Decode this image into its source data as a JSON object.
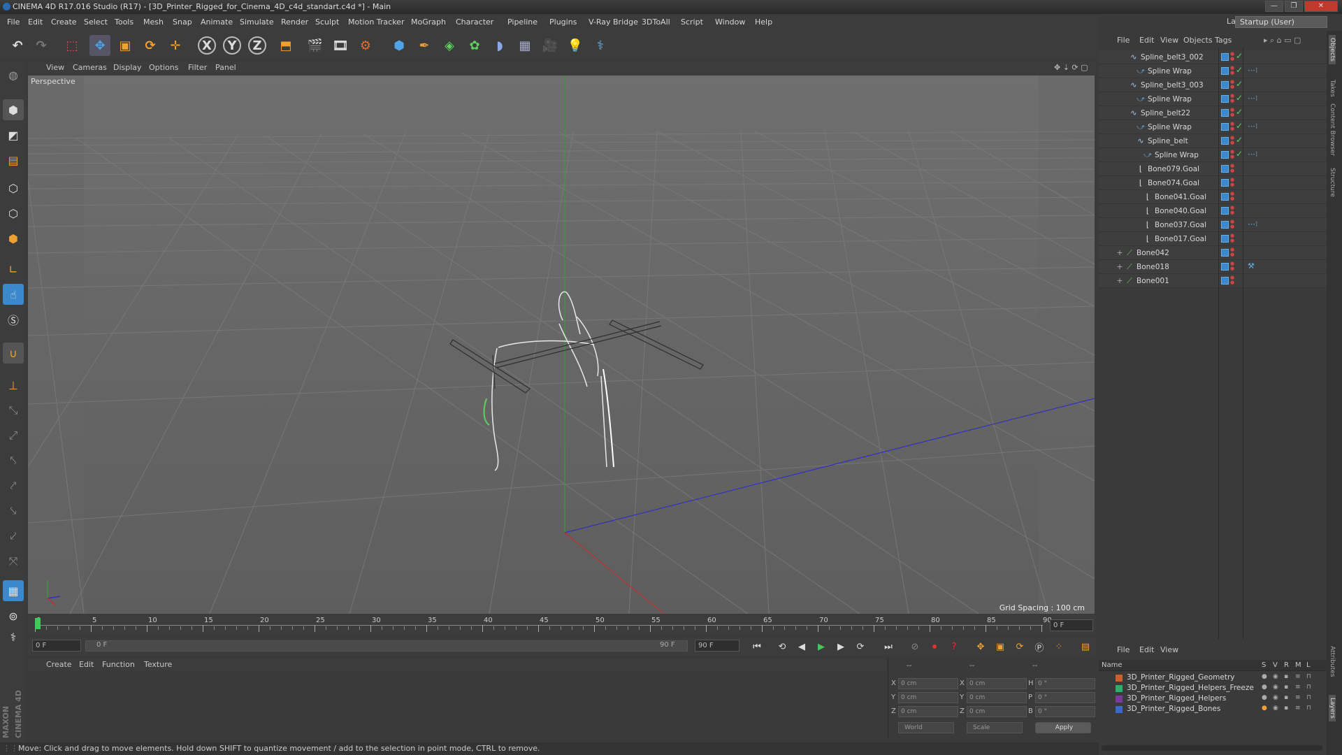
{
  "titlebar": {
    "title": "CINEMA 4D R17.016 Studio (R17) - [3D_Printer_Rigged_for_Cinema_4D_c4d_standart.c4d *] - Main",
    "min": "—",
    "max": "❐",
    "close": "✕"
  },
  "menubar": {
    "items": [
      "File",
      "Edit",
      "Create",
      "Select",
      "Tools",
      "Mesh",
      "Snap",
      "Animate",
      "Simulate",
      "Render",
      "Sculpt",
      "Motion Tracker",
      "MoGraph",
      "Character",
      "Pipeline",
      "Plugins",
      "V-Ray Bridge",
      "3DToAll",
      "Script",
      "Window",
      "Help"
    ],
    "layout_label": "Layout:",
    "layout_value": "Startup (User)"
  },
  "toolbar": {
    "icons": [
      "undo-icon",
      "redo-icon",
      "live-selection-icon",
      "move-icon",
      "scale-icon",
      "rotate-icon",
      "transform-icon",
      "x-axis-icon",
      "y-axis-icon",
      "z-axis-icon",
      "coordinate-system-icon",
      "render-view-icon",
      "render-picture-viewer-icon",
      "render-settings-icon",
      "cube-icon",
      "pen-icon",
      "subdivision-icon",
      "array-icon",
      "deformer-icon",
      "floor-icon",
      "camera-icon",
      "light-icon",
      "python-icon"
    ],
    "axis_x": "X",
    "axis_y": "Y",
    "axis_z": "Z"
  },
  "viewport": {
    "menu": [
      "View",
      "Cameras",
      "Display",
      "Options",
      "Filter",
      "Panel"
    ],
    "label": "Perspective",
    "grid_spacing": "Grid Spacing : 100 cm"
  },
  "timeline": {
    "ticks": [
      "0",
      "5",
      "10",
      "15",
      "20",
      "25",
      "30",
      "35",
      "40",
      "45",
      "50",
      "55",
      "60",
      "65",
      "70",
      "75",
      "80",
      "85",
      "90"
    ],
    "current_frame": "0 F"
  },
  "transport": {
    "start": "0 F",
    "range_start": "0 F",
    "range_end": "90 F",
    "end": "90 F"
  },
  "material_manager": {
    "menu": [
      "Create",
      "Edit",
      "Function",
      "Texture"
    ]
  },
  "coordinates": {
    "header": [
      "--",
      "--",
      "--"
    ],
    "rows": [
      {
        "a": "X",
        "av": "0 cm",
        "b": "X",
        "bv": "0 cm",
        "c": "H",
        "cv": "0 °"
      },
      {
        "a": "Y",
        "av": "0 cm",
        "b": "Y",
        "bv": "0 cm",
        "c": "P",
        "cv": "0 °"
      },
      {
        "a": "Z",
        "av": "0 cm",
        "b": "Z",
        "bv": "0 cm",
        "c": "B",
        "cv": "0 °"
      }
    ],
    "world": "World",
    "scale": "Scale",
    "apply": "Apply"
  },
  "object_manager": {
    "menu": [
      "File",
      "Edit",
      "View",
      "Objects",
      "Tags"
    ],
    "objects": [
      {
        "name": "Spline_belt3_002",
        "type": "spline",
        "check": true,
        "tag": false
      },
      {
        "name": "Spline Wrap",
        "type": "wrap",
        "check": true,
        "tag": true
      },
      {
        "name": "Spline_belt3_003",
        "type": "spline",
        "check": true,
        "tag": false
      },
      {
        "name": "Spline Wrap",
        "type": "wrap",
        "check": true,
        "tag": true
      },
      {
        "name": "Spline_belt22",
        "type": "spline",
        "check": true,
        "tag": false
      },
      {
        "name": "Spline Wrap",
        "type": "wrap",
        "check": true,
        "tag": true
      },
      {
        "name": "Spline_belt",
        "type": "spline",
        "check": true,
        "tag": false
      },
      {
        "name": "Spline Wrap",
        "type": "wrap",
        "check": true,
        "tag": true
      },
      {
        "name": "Bone079.Goal",
        "type": "null",
        "check": false,
        "tag": false
      },
      {
        "name": "Bone074.Goal",
        "type": "null",
        "check": false,
        "tag": false
      },
      {
        "name": "Bone041.Goal",
        "type": "null",
        "check": false,
        "tag": false
      },
      {
        "name": "Bone040.Goal",
        "type": "null",
        "check": false,
        "tag": false
      },
      {
        "name": "Bone037.Goal",
        "type": "null",
        "check": false,
        "tag": true
      },
      {
        "name": "Bone017.Goal",
        "type": "null",
        "check": false,
        "tag": false
      },
      {
        "name": "Bone042",
        "type": "bone",
        "check": false,
        "tag": false
      },
      {
        "name": "Bone018",
        "type": "bone",
        "check": false,
        "tag": true
      },
      {
        "name": "Bone001",
        "type": "bone",
        "check": false,
        "tag": false
      }
    ]
  },
  "layer_manager": {
    "menu": [
      "File",
      "Edit",
      "View"
    ],
    "columns": {
      "name": "Name",
      "s": "S",
      "v": "V",
      "r": "R",
      "m": "M",
      "l": "L"
    },
    "layers": [
      {
        "name": "3D_Printer_Rigged_Geometry",
        "color": "#c8622a"
      },
      {
        "name": "3D_Printer_Rigged_Helpers_Freeze",
        "color": "#2ab06a"
      },
      {
        "name": "3D_Printer_Rigged_Helpers",
        "color": "#7a3a9a"
      },
      {
        "name": "3D_Printer_Rigged_Bones",
        "color": "#3a6ac8"
      }
    ]
  },
  "right_tabs": [
    "Objects",
    "Takes",
    "Content Browser",
    "Structure",
    "Attributes",
    "Layers"
  ],
  "status": "Move: Click and drag to move elements. Hold down SHIFT to quantize movement / add to the selection in point mode, CTRL to remove.",
  "brand": "MAXON CINEMA 4D"
}
